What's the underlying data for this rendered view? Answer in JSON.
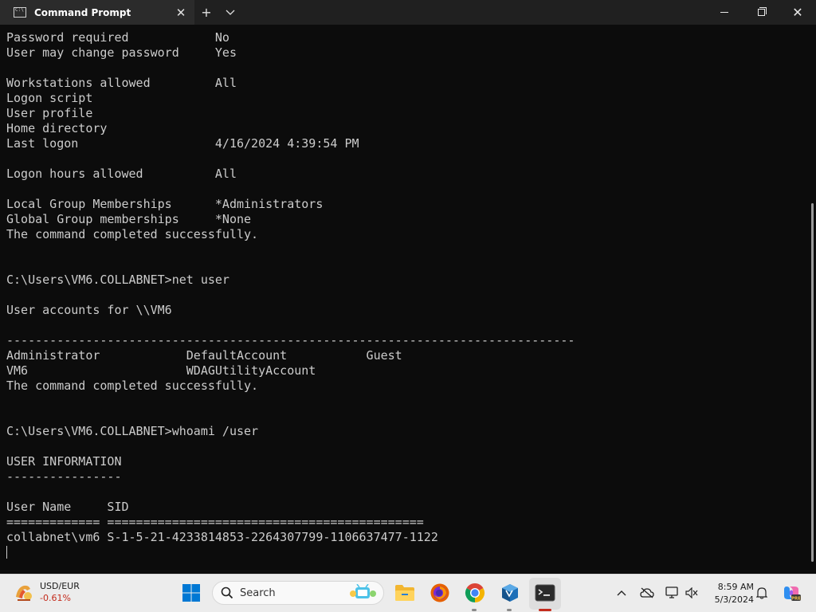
{
  "window": {
    "tab_title": "Command Prompt",
    "tab_close": "✕",
    "new_tab": "+",
    "dropdown": "⌄",
    "minimize": "",
    "maximize": "",
    "close": "✕"
  },
  "console": {
    "lines": [
      "Password required            No",
      "User may change password     Yes",
      "",
      "Workstations allowed         All",
      "Logon script",
      "User profile",
      "Home directory",
      "Last logon                   4/16/2024 4:39:54 PM",
      "",
      "Logon hours allowed          All",
      "",
      "Local Group Memberships      *Administrators",
      "Global Group memberships     *None",
      "The command completed successfully.",
      "",
      "",
      "C:\\Users\\VM6.COLLABNET>net user",
      "",
      "User accounts for \\\\VM6",
      "",
      "-------------------------------------------------------------------------------",
      "Administrator            DefaultAccount           Guest",
      "VM6                      WDAGUtilityAccount",
      "The command completed successfully.",
      "",
      "",
      "C:\\Users\\VM6.COLLABNET>whoami /user",
      "",
      "USER INFORMATION",
      "----------------",
      "",
      "User Name     SID",
      "============= ============================================",
      "collabnet\\vm6 S-1-5-21-4233814853-2264307799-1106637477-1122"
    ]
  },
  "taskbar": {
    "widget_name": "USD/EUR",
    "widget_value": "-0.61%",
    "search_label": "Search",
    "clock_time": "8:59 AM",
    "clock_date": "5/3/2024",
    "colors": {
      "chrome_red": "#db4437",
      "chrome_yellow": "#f4b400",
      "chrome_green": "#0f9d58",
      "chrome_blue": "#4285f4",
      "indicator_active": "#c42b1c",
      "indicator_inactive": "#8a8a8a",
      "widget_negative": "#c42b1c"
    }
  }
}
